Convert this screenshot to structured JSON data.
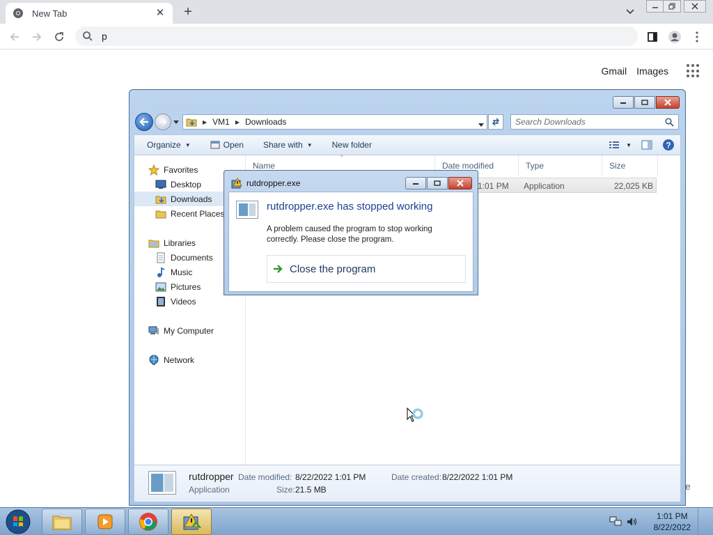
{
  "browser": {
    "tab_title": "New Tab",
    "omnibox_text": "p",
    "links": {
      "gmail": "Gmail",
      "images": "Images"
    },
    "partial_text_right": "e"
  },
  "explorer": {
    "breadcrumb": [
      "VM1",
      "Downloads"
    ],
    "search_placeholder": "Search Downloads",
    "command_bar": {
      "organize": "Organize",
      "open": "Open",
      "share_with": "Share with",
      "new_folder": "New folder"
    },
    "nav": {
      "favorites": "Favorites",
      "desktop": "Desktop",
      "downloads": "Downloads",
      "recent_places": "Recent Places",
      "libraries": "Libraries",
      "documents": "Documents",
      "music": "Music",
      "pictures": "Pictures",
      "videos": "Videos",
      "my_computer": "My Computer",
      "network": "Network"
    },
    "columns": {
      "name": "Name",
      "date_modified": "Date modified",
      "type": "Type",
      "size": "Size"
    },
    "file": {
      "date_partial": "1:01 PM",
      "type": "Application",
      "size": "22,025 KB"
    },
    "details": {
      "name": "rutdropper",
      "kind": "Application",
      "date_modified_label": "Date modified:",
      "date_modified": "8/22/2022 1:01 PM",
      "size_label": "Size:",
      "size": "21.5 MB",
      "date_created_label": "Date created:",
      "date_created": "8/22/2022 1:01 PM"
    }
  },
  "error_dialog": {
    "title": "rutdropper.exe",
    "heading": "rutdropper.exe has stopped working",
    "message": "A problem caused the program to stop working correctly. Please close the program.",
    "button": "Close the program"
  },
  "taskbar": {
    "time": "1:01 PM",
    "date": "8/22/2022"
  },
  "colors": {
    "chrome_tabbar": "#dee1e6",
    "explorer_frame": "#bcd4ee",
    "error_heading": "#1b3f8f",
    "taskbar": "#8fb0d6"
  }
}
